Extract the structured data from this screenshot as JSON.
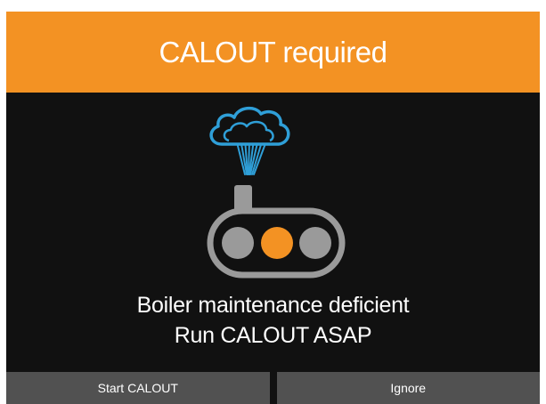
{
  "dialog": {
    "title": "CALOUT required",
    "message_line1": "Boiler maintenance deficient",
    "message_line2": "Run CALOUT ASAP",
    "buttons": {
      "start": "Start CALOUT",
      "ignore": "Ignore"
    }
  },
  "illustration": {
    "icons": [
      "cloud-icon",
      "signal-rays-icon",
      "traffic-light-device-icon"
    ],
    "indicator_states": [
      "off",
      "on",
      "off"
    ]
  },
  "colors": {
    "header": "#f39223",
    "background": "#111111",
    "button": "#515151",
    "cloud": "#2f9fd8",
    "device_frame": "#9a9a9a",
    "lamp_off": "#9a9a9a",
    "lamp_on": "#f39223"
  }
}
